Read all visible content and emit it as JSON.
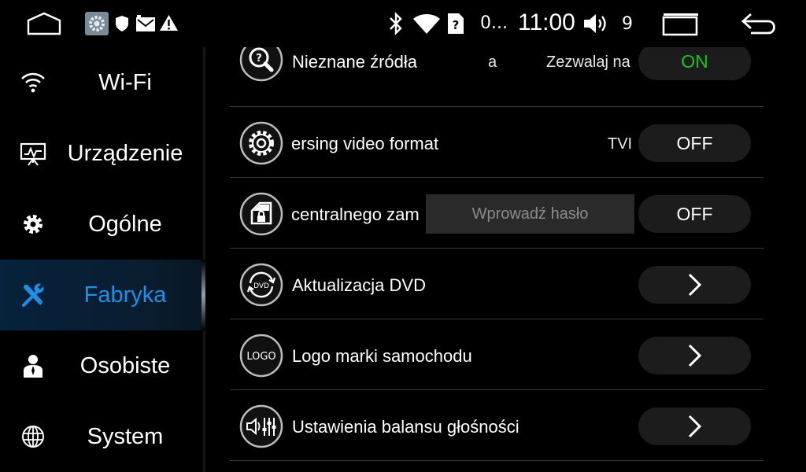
{
  "statusbar": {
    "media_text": "0...",
    "clock": "11:00",
    "volume_level": "9",
    "icons": [
      "home-icon",
      "settings-app-icon",
      "shield-icon",
      "mail-icon",
      "warning-icon",
      "bluetooth-icon",
      "wifi-icon",
      "sim-unknown-icon",
      "volume-icon",
      "recent-apps-icon",
      "back-icon"
    ]
  },
  "sidebar": {
    "items": [
      {
        "label": "Wi-Fi",
        "icon": "wifi-icon"
      },
      {
        "label": "Urządzenie",
        "icon": "device-icon"
      },
      {
        "label": "Ogólne",
        "icon": "gear-icon"
      },
      {
        "label": "Fabryka",
        "icon": "tools-icon",
        "active": true
      },
      {
        "label": "Osobiste",
        "icon": "person-icon"
      },
      {
        "label": "System",
        "icon": "globe-icon"
      }
    ],
    "active_color": "#1e90e6"
  },
  "rows": [
    {
      "label": "Nieznane źródła",
      "aux1": "a",
      "aux2": "Zezwalaj na",
      "control": "ON",
      "icon": "unknown-source-icon"
    },
    {
      "label": "ersing video format",
      "aux2": "TVI",
      "control": "OFF",
      "icon": "gear-circle-icon"
    },
    {
      "label": "centralnego zam",
      "control": "OFF",
      "icon": "door-lock-icon"
    },
    {
      "label": "Aktualizacja DVD",
      "control": ">",
      "icon": "dvd-update-icon"
    },
    {
      "label": "Logo marki samochodu",
      "control": ">",
      "icon": "logo-icon"
    },
    {
      "label": "Ustawienia balansu głośności",
      "control": ">",
      "icon": "volume-balance-icon"
    }
  ],
  "icon_text": {
    "dvd": "DVD",
    "logo": "LOGO"
  },
  "password_prompt": {
    "placeholder": "Wprowadź hasło"
  },
  "colors": {
    "on": "#19c519",
    "pill_bg": "#1c1c1c",
    "background": "#000000"
  }
}
